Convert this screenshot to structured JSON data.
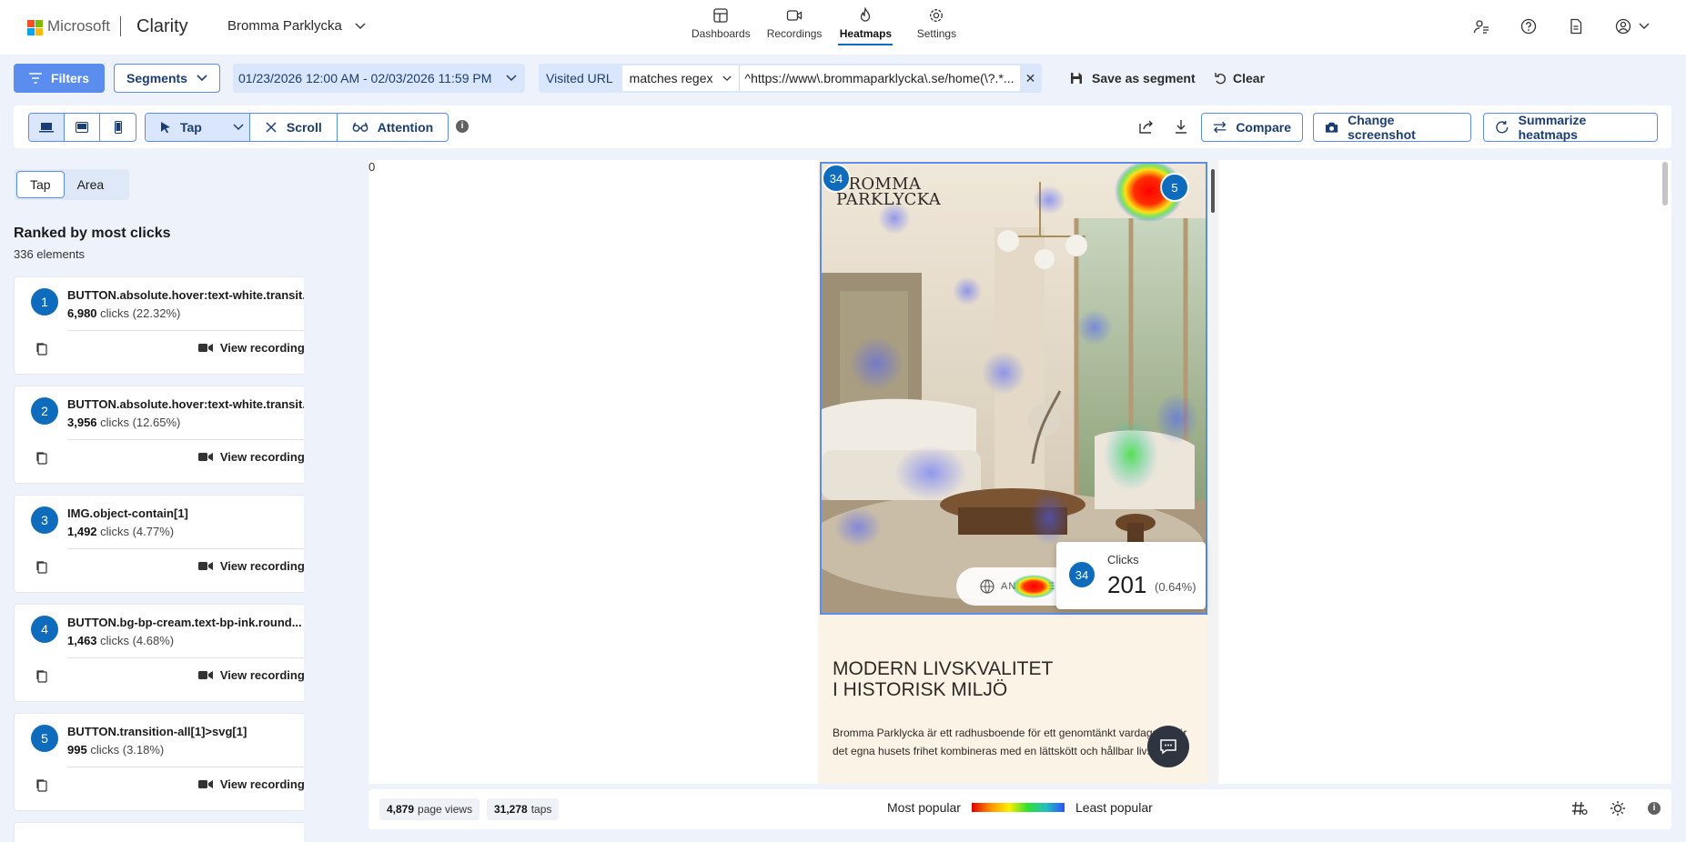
{
  "header": {
    "ms_label": "Microsoft",
    "app_name": "Clarity",
    "project": "Bromma Parklycka",
    "nav": [
      {
        "label": "Dashboards",
        "icon": "dashboard-icon"
      },
      {
        "label": "Recordings",
        "icon": "video-icon"
      },
      {
        "label": "Heatmaps",
        "icon": "flame-icon",
        "active": true
      },
      {
        "label": "Settings",
        "icon": "gear-icon"
      }
    ],
    "right_icons": [
      "share-people-icon",
      "help-icon",
      "document-icon",
      "account-icon"
    ]
  },
  "filters": {
    "filters_label": "Filters",
    "segments_label": "Segments",
    "date_range": "01/23/2026 12:00 AM - 02/03/2026 11:59 PM",
    "url_label": "Visited URL",
    "url_operator": "matches regex",
    "url_value": "^https://www\\.brommaparklycka\\.se/home(\\?.*...",
    "save_segment": "Save as segment",
    "clear": "Clear"
  },
  "toolbar": {
    "devices": [
      "desktop-icon",
      "tablet-icon",
      "mobile-icon"
    ],
    "modes": [
      "Tap",
      "Scroll",
      "Attention"
    ],
    "compare": "Compare",
    "change_screenshot": "Change screenshot",
    "summarize": "Summarize heatmaps"
  },
  "sidebar": {
    "tabs": [
      "Tap",
      "Area"
    ],
    "heading": "Ranked by most clicks",
    "count": "336 elements",
    "view_recordings": "View recordings",
    "items": [
      {
        "rank": "1",
        "name": "BUTTON.absolute.hover:text-white.transit...",
        "clicks": "6,980",
        "clicks_word": "clicks",
        "pct": "(22.32%)"
      },
      {
        "rank": "2",
        "name": "BUTTON.absolute.hover:text-white.transit...",
        "clicks": "3,956",
        "clicks_word": "clicks",
        "pct": "(12.65%)"
      },
      {
        "rank": "3",
        "name": "IMG.object-contain[1]",
        "clicks": "1,492",
        "clicks_word": "clicks",
        "pct": "(4.77%)"
      },
      {
        "rank": "4",
        "name": "BUTTON.bg-bp-cream.text-bp-ink.round...",
        "clicks": "1,463",
        "clicks_word": "clicks",
        "pct": "(4.68%)"
      },
      {
        "rank": "5",
        "name": "BUTTON.transition-all[1]>svg[1]",
        "clicks": "995",
        "clicks_word": "clicks",
        "pct": "(3.18%)"
      }
    ]
  },
  "canvas": {
    "scroll_marker": "0",
    "brand_line1": "BROMMA",
    "brand_line2": "PARKLYCKA",
    "badge_left": "34",
    "badge_right": "5",
    "pill_text": "ANIMA    SE",
    "title_line1": "MODERN LIVSKVALITET",
    "title_line2": "I HISTORISK MILJÖ",
    "body_text": "Bromma Parklycka är ett radhusboende för ett genomtänkt vardagsliv där det egna husets frihet kombineras med en lättskött och hållbar livsstil.",
    "tooltip": {
      "badge": "34",
      "label": "Clicks",
      "value": "201",
      "pct": "(0.64%)"
    }
  },
  "footer": {
    "page_views": "4,879",
    "page_views_label": "page views",
    "taps": "31,278",
    "taps_label": "taps",
    "most": "Most popular",
    "least": "Least popular"
  },
  "colors": {
    "accent": "#0f6cbd",
    "filter_blue": "#5b8def",
    "pill_bg": "#d9e6fb",
    "app_bg": "#eef3fb"
  }
}
